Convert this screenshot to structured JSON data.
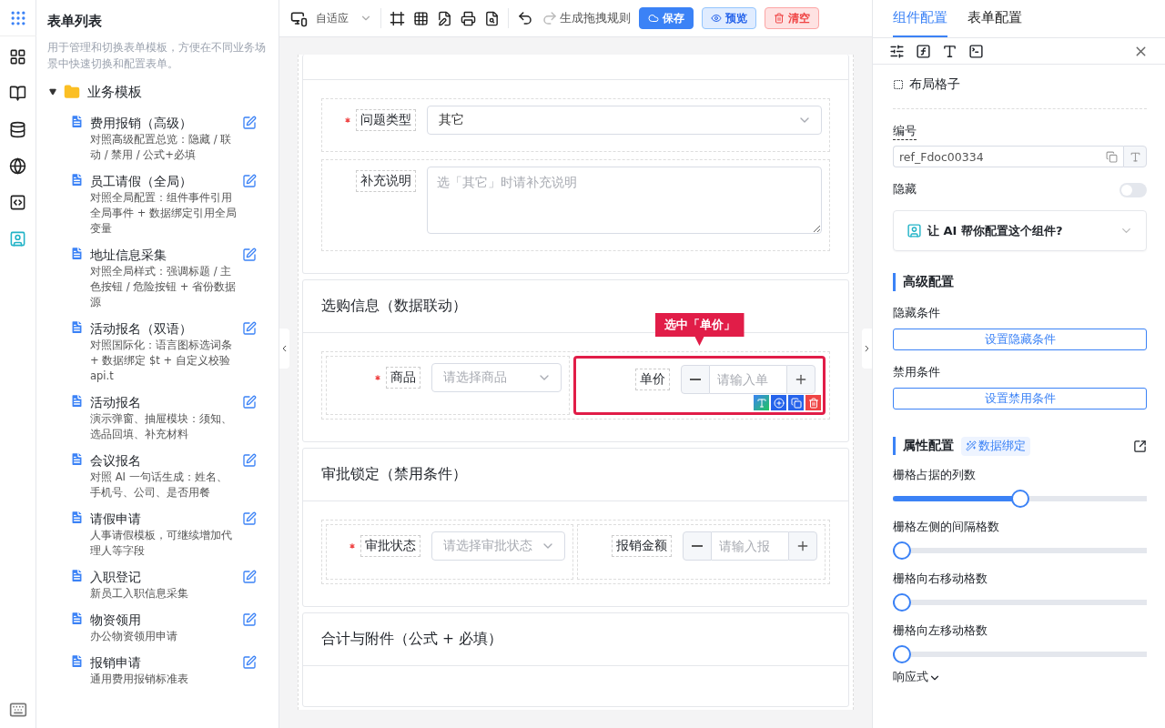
{
  "sidebar": {
    "title": "表单列表",
    "description": "用于管理和切换表单模板，方便在不同业务场景中快速切换和配置表单。",
    "folder": {
      "label": "业务模板",
      "expanded": true,
      "children": [
        {
          "title": "费用报销（高级）",
          "description": "对照高级配置总览：隐藏 / 联动 / 禁用 / 公式+必填"
        },
        {
          "title": "员工请假（全局）",
          "description": "对照全局配置：组件事件引用全局事件 + 数据绑定引用全局变量"
        },
        {
          "title": "地址信息采集",
          "description": "对照全局样式：强调标题 / 主色按钮 / 危险按钮 + 省份数据源"
        },
        {
          "title": "活动报名（双语）",
          "description": "对照国际化：语言图标选词条 + 数据绑定 $t + 自定义校验 api.t"
        },
        {
          "title": "活动报名",
          "description": "演示弹窗、抽屉模块：须知、选品回填、补充材料"
        },
        {
          "title": "会议报名",
          "description": "对照 AI 一句话生成：姓名、手机号、公司、是否用餐"
        },
        {
          "title": "请假申请",
          "description": "人事请假模板，可继续增加代理人等字段"
        },
        {
          "title": "入职登记",
          "description": "新员工入职信息采集"
        },
        {
          "title": "物资领用",
          "description": "办公物资领用申请"
        },
        {
          "title": "报销申请",
          "description": "通用费用报销标准表"
        }
      ]
    }
  },
  "toolbar": {
    "device": "自适应",
    "redo_label": "生成拖拽规则",
    "buttons": [
      {
        "label": "保存",
        "kind": "primary"
      },
      {
        "label": "预览",
        "kind": "secondary"
      },
      {
        "label": "清空",
        "kind": "danger"
      }
    ]
  },
  "canvas": {
    "sections": [
      {
        "rows": [
          [
            {
              "kind": "select",
              "label": "问题类型",
              "required": true,
              "value": "其它",
              "selected": false
            }
          ],
          [
            {
              "kind": "textarea",
              "label": "补充说明",
              "required": false,
              "placeholder": "选「其它」时请补充说明",
              "selected": false
            }
          ]
        ]
      },
      {
        "title": "选购信息（数据联动）",
        "rows": [
          [
            {
              "kind": "select",
              "label": "商品",
              "required": true,
              "placeholder": "请选择商品",
              "selected": false
            },
            {
              "kind": "number",
              "label": "单价",
              "required": false,
              "placeholder": "请输入单",
              "selected": true,
              "tooltip": "选中「单价」"
            }
          ]
        ]
      },
      {
        "title": "审批锁定（禁用条件）",
        "rows": [
          [
            {
              "kind": "select",
              "label": "审批状态",
              "required": true,
              "placeholder": "请选择审批状态",
              "selected": false
            },
            {
              "kind": "number",
              "label": "报销金额",
              "required": false,
              "placeholder": "请输入报",
              "selected": false
            }
          ]
        ]
      },
      {
        "title": "合计与附件（公式 + 必填）"
      }
    ]
  },
  "panel": {
    "tabs": [
      {
        "label": "组件配置",
        "selected": true
      },
      {
        "label": "表单配置",
        "selected": false
      }
    ],
    "component": "布局格子",
    "id_label": "编号",
    "id_value": "ref_Fdoc00334",
    "hidden": {
      "label": "隐藏",
      "on": false
    },
    "ai_prompt": "让 AI 帮你配置这个组件?",
    "advanced": {
      "title": "高级配置",
      "items": [
        {
          "label": "隐藏条件",
          "button": "设置隐藏条件"
        },
        {
          "label": "禁用条件",
          "button": "设置禁用条件"
        }
      ]
    },
    "props": {
      "title": "属性配置",
      "tag": "数据绑定",
      "sliders": [
        {
          "label": "栅格占据的列数",
          "level": 0.5
        },
        {
          "label": "栅格左侧的间隔格数",
          "level": 0
        },
        {
          "label": "栅格向右移动格数",
          "level": 0
        },
        {
          "label": "栅格向左移动格数",
          "level": 0
        }
      ],
      "more": "响应式"
    }
  }
}
